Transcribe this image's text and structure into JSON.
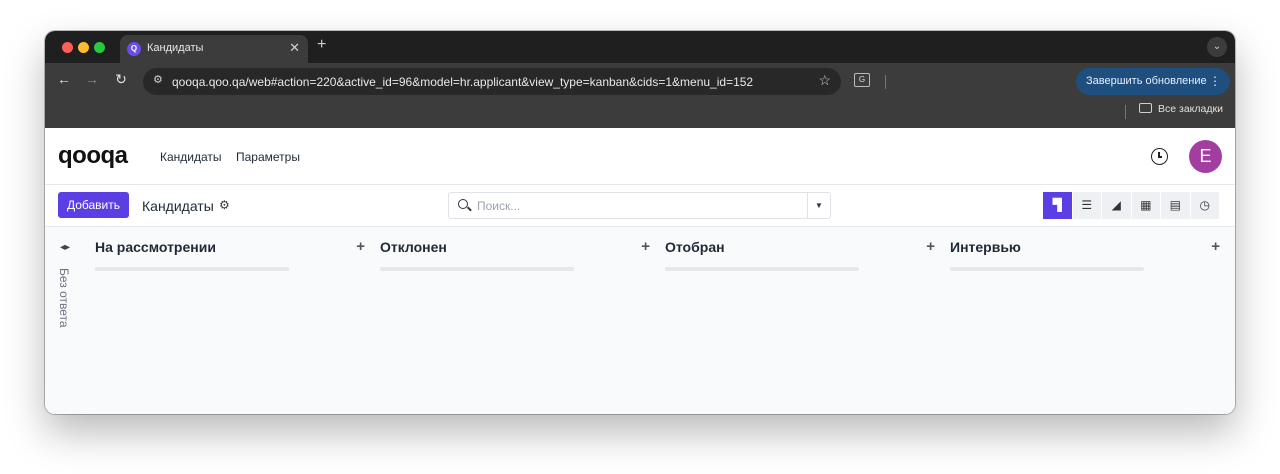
{
  "browser": {
    "tab_title": "Кандидаты",
    "tab_favicon": "Q",
    "url": "qooqa.qoo.qa/web#action=220&active_id=96&model=hr.applicant&view_type=kanban&cids=1&menu_id=152",
    "update_button": "Завершить обновление",
    "bookmarks_label": "Все закладки"
  },
  "app": {
    "logo": "qooqa",
    "menu": [
      "Кандидаты",
      "Параметры"
    ],
    "avatar_initial": "E"
  },
  "control": {
    "add_button": "Добавить",
    "breadcrumb": "Кандидаты",
    "search_placeholder": "Поиск..."
  },
  "board": {
    "folded_column": "Без ответа",
    "columns": [
      {
        "title": "На рассмотрении"
      },
      {
        "title": "Отклонен"
      },
      {
        "title": "Отобран"
      },
      {
        "title": "Интервью"
      }
    ]
  },
  "colors": {
    "accent": "#5b3fe4",
    "avatar": "#a33ea1",
    "update_button": "#1e4f7e"
  },
  "icons": [
    "search-icon",
    "gear-icon",
    "clock-icon",
    "kanban-view-icon",
    "list-view-icon",
    "graph-view-icon",
    "calendar-view-icon",
    "pivot-view-icon",
    "activity-view-icon"
  ]
}
